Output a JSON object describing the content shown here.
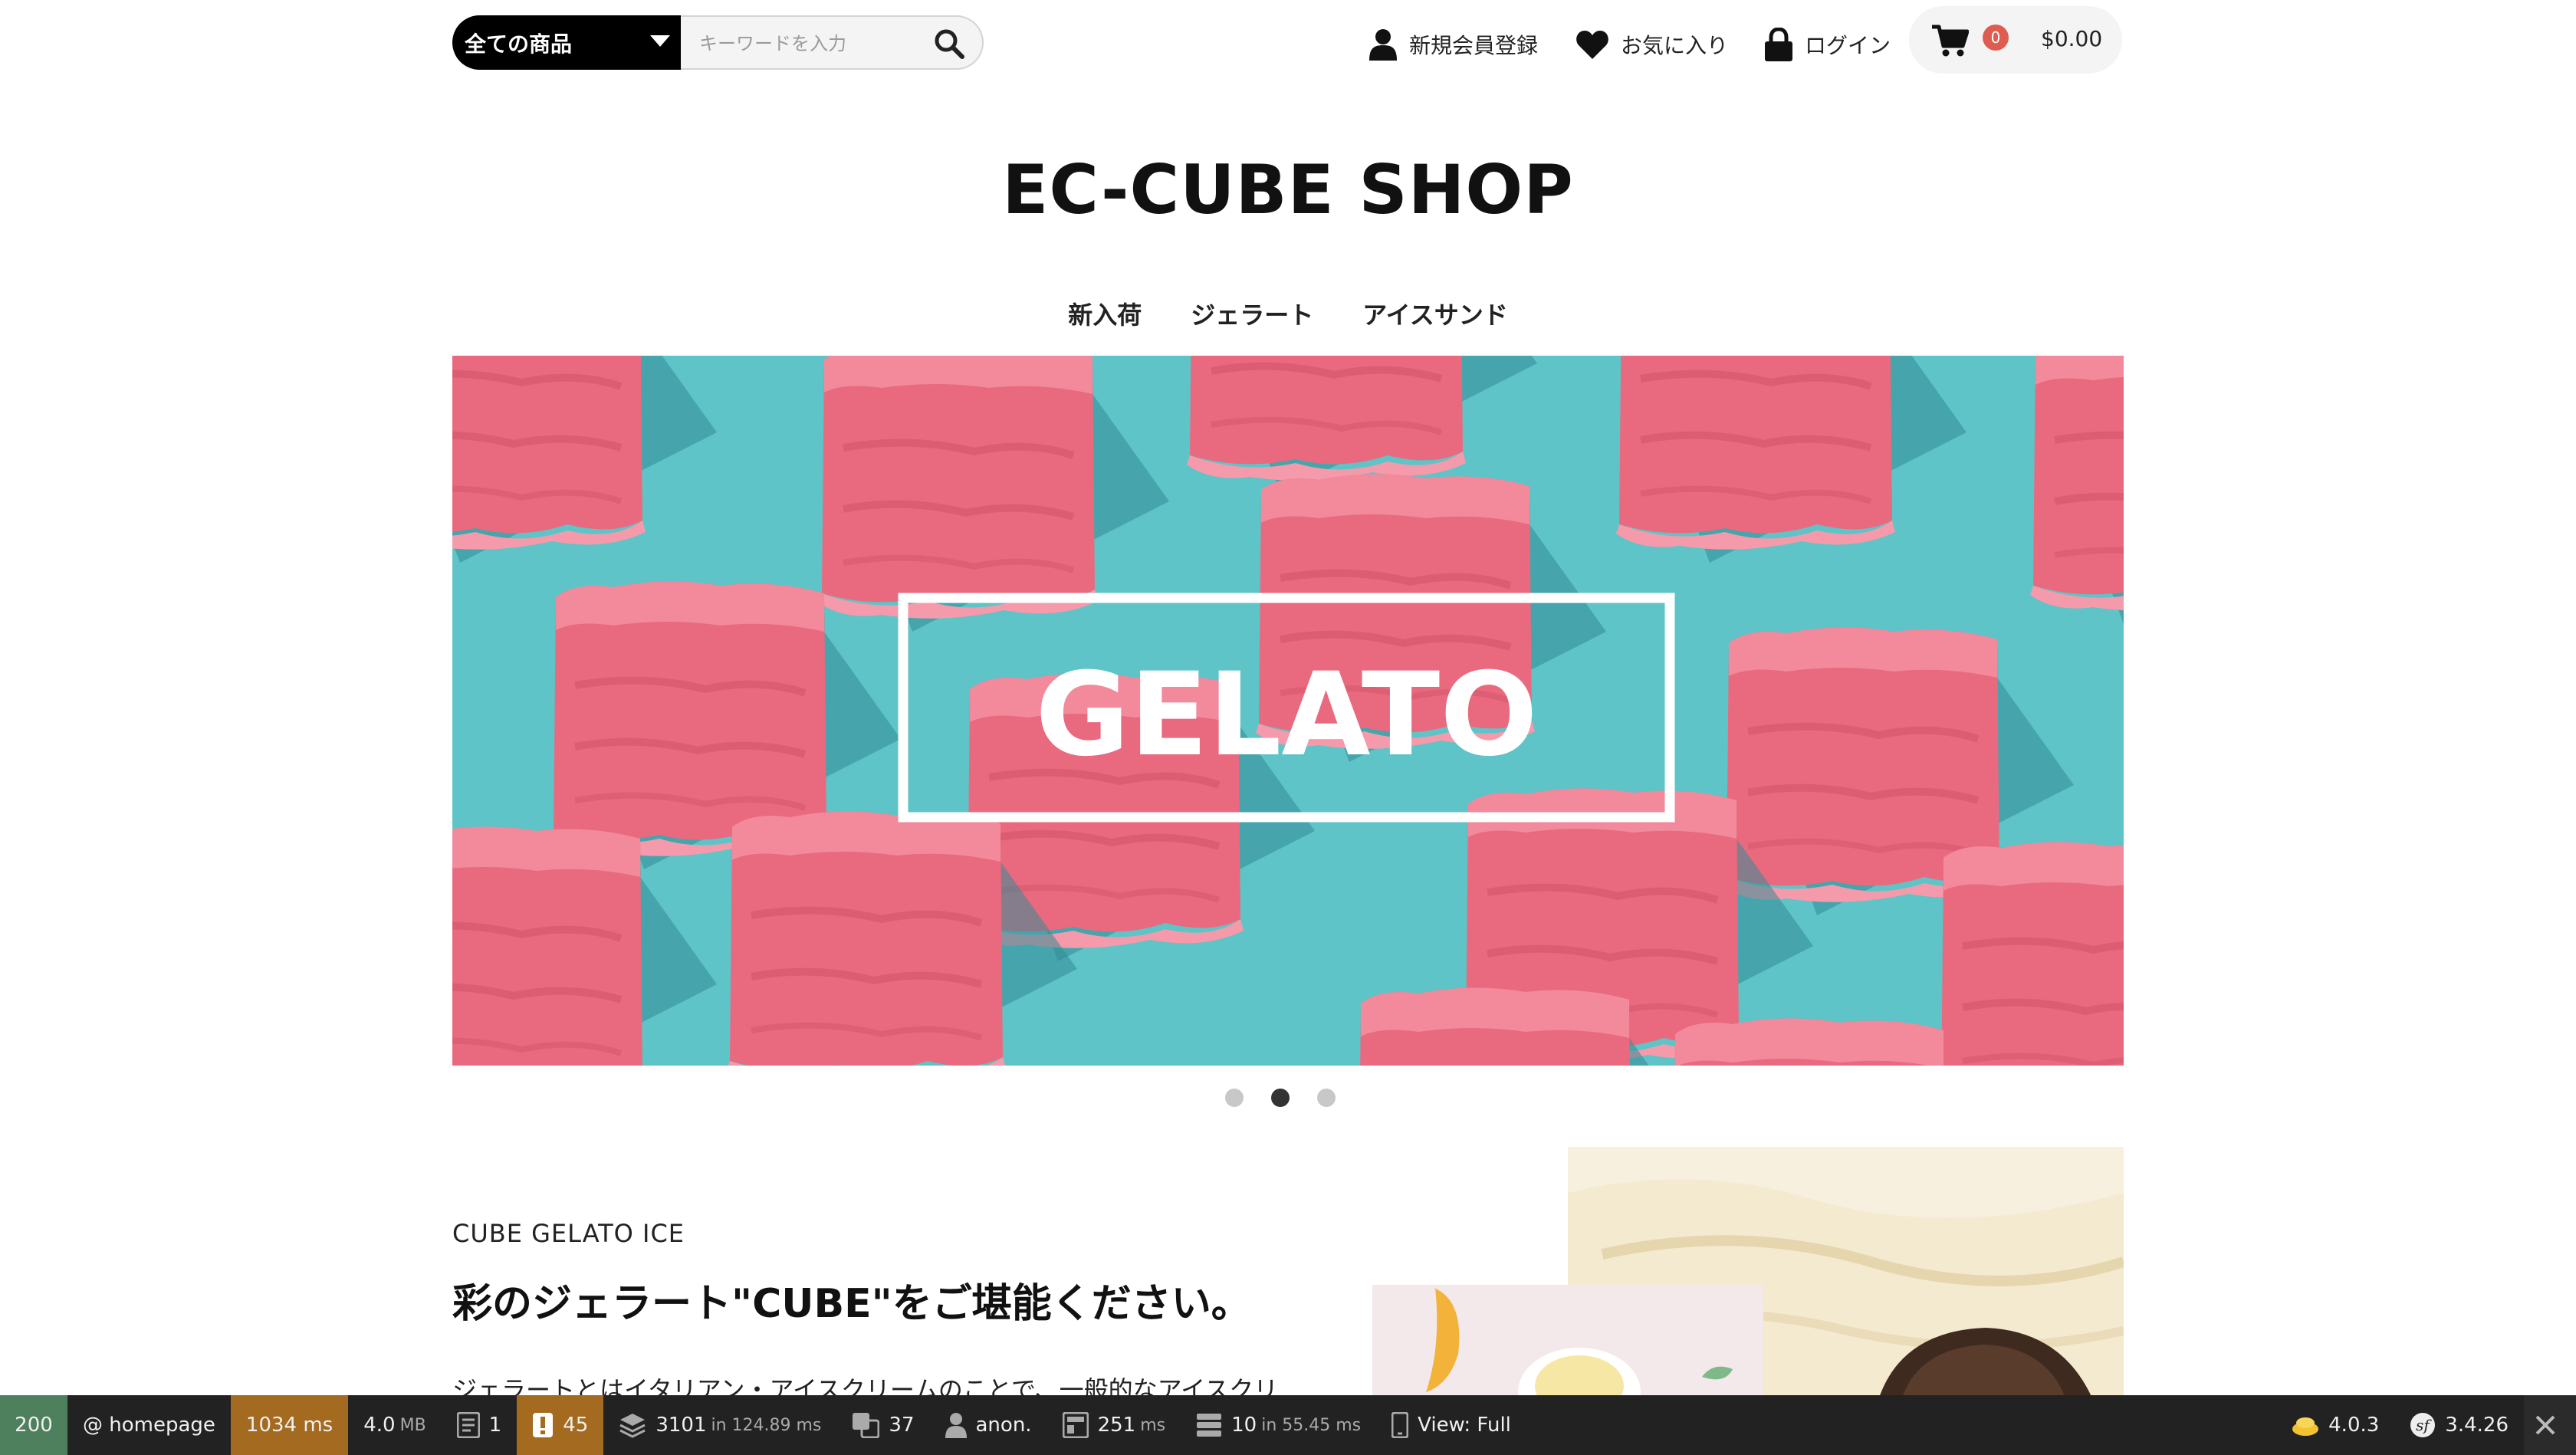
{
  "header": {
    "category_select": "全ての商品",
    "search_placeholder": "キーワードを入力",
    "nav": {
      "register": "新規会員登録",
      "favorites": "お気に入り",
      "login": "ログイン"
    },
    "cart": {
      "count": "0",
      "total": "$0.00"
    }
  },
  "shop": {
    "title": "EC-CUBE SHOP",
    "menu": [
      "新入荷",
      "ジェラート",
      "アイスサンド"
    ]
  },
  "hero": {
    "label": "GELATO",
    "colors": {
      "background": "#5ec4c8",
      "cube": "#e7667d",
      "frame": "#ffffff"
    },
    "slide_count": 3,
    "active_slide": 2
  },
  "about": {
    "subtitle": "CUBE GELATO ICE",
    "heading": "彩のジェラート\"CUBE\"をご堪能ください。",
    "body": "ジェラートとはイタリアン・アイスクリームのことで、一般的なアイスクリ"
  },
  "toolbar": {
    "status": "200",
    "route": "@ homepage",
    "time": "1034 ms",
    "memory_value": "4.0",
    "memory_unit": "MB",
    "requests": "1",
    "warnings": "45",
    "db_queries": "3101",
    "db_time": "in 124.89 ms",
    "translations": "37",
    "user": "anon.",
    "twig_time": "251",
    "twig_unit": "ms",
    "cache_calls": "10",
    "cache_time": "in 55.45 ms",
    "view": "View: Full",
    "eccube_version": "4.0.3",
    "symfony_version": "3.4.26"
  }
}
